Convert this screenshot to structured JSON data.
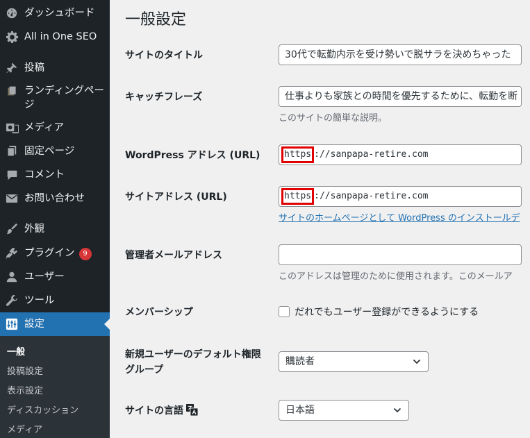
{
  "sidebar": {
    "items": [
      {
        "label": "ダッシュボード",
        "icon": "dashboard-icon"
      },
      {
        "label": "All in One SEO",
        "icon": "gear-icon"
      },
      {
        "label": "投稿",
        "icon": "pin-icon"
      },
      {
        "label": "ランディングページ",
        "icon": "landing-page-icon"
      },
      {
        "label": "メディア",
        "icon": "media-icon"
      },
      {
        "label": "固定ページ",
        "icon": "page-icon"
      },
      {
        "label": "コメント",
        "icon": "comment-icon"
      },
      {
        "label": "お問い合わせ",
        "icon": "mail-icon"
      },
      {
        "label": "外観",
        "icon": "brush-icon"
      },
      {
        "label": "プラグイン",
        "icon": "plugin-icon",
        "badge": "9"
      },
      {
        "label": "ユーザー",
        "icon": "user-icon"
      },
      {
        "label": "ツール",
        "icon": "wrench-icon"
      },
      {
        "label": "設定",
        "icon": "settings-icon",
        "current": true
      }
    ],
    "submenu": [
      "一般",
      "投稿設定",
      "表示設定",
      "ディスカッション",
      "メディア"
    ]
  },
  "page": {
    "title": "一般設定",
    "site_title": {
      "label": "サイトのタイトル",
      "value": "30代で転勤内示を受け勢いで脱サラを決めちゃった"
    },
    "tagline": {
      "label": "キャッチフレーズ",
      "value": "仕事よりも家族との時間を優先するために、転勤を断",
      "description": "このサイトの簡単な説明。"
    },
    "wp_address": {
      "label": "WordPress アドレス (URL)",
      "scheme": "https",
      "rest": "://sanpapa-retire.com"
    },
    "site_address": {
      "label": "サイトアドレス (URL)",
      "scheme": "https",
      "rest": "://sanpapa-retire.com",
      "link": "サイトのホームページとして WordPress のインストールデ"
    },
    "admin_email": {
      "label": "管理者メールアドレス",
      "value": "",
      "description": "このアドレスは管理のために使用されます。このメールア"
    },
    "membership": {
      "label": "メンバーシップ",
      "checkbox_label": "だれでもユーザー登録ができるようにする",
      "checked": false
    },
    "default_role": {
      "label": "新規ユーザーのデフォルト権限グループ",
      "value": "購読者"
    },
    "language": {
      "label": "サイトの言語",
      "value": "日本語"
    }
  },
  "colors": {
    "sidebar_bg": "#1d2327",
    "current_bg": "#2271b1",
    "badge": "#d63638",
    "highlight": "#e00000",
    "link": "#2271b1"
  }
}
